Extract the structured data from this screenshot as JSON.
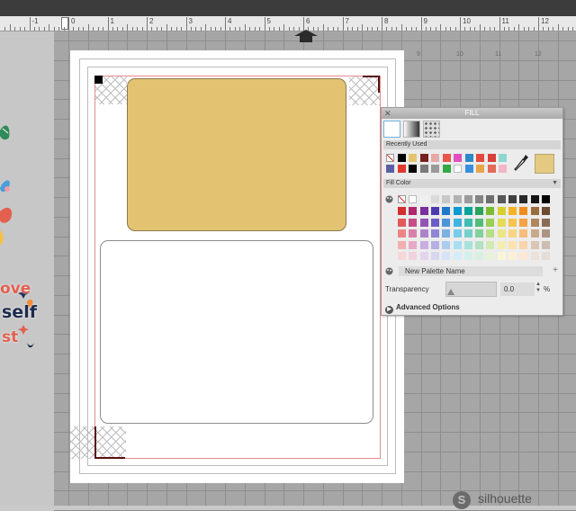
{
  "ruler": {
    "labels": [
      "-1",
      "0",
      "1",
      "2",
      "3",
      "4",
      "5",
      "6",
      "7",
      "8",
      "9",
      "10",
      "11",
      "12"
    ]
  },
  "mat": {
    "numbers": [
      "9",
      "10",
      "11",
      "12"
    ]
  },
  "fill_panel": {
    "title": "FILL",
    "close_glyph": "✕",
    "recently_used_label": "Recently Used",
    "fill_color_label": "Fill Color",
    "palette_name_placeholder": "New Palette Name",
    "transparency_label": "Transparency",
    "transparency_value": "0.0",
    "percent_symbol": "%",
    "advanced_options_label": "Advanced Options",
    "selected_color": "#e4c983",
    "recent_colors_row1": [
      "none",
      "#000000",
      "#e4c46f",
      "#7a1f1f",
      "#e7a9a6",
      "#e8564a",
      "#e04fc0",
      "#2f88c8",
      "#e24a3e",
      "#d9403a",
      "#8fd6d0"
    ],
    "recent_colors_row2": [
      "#5a5fa8",
      "#e03a2e",
      "#000000",
      "#7a7a7a",
      "#9a9a9a",
      "#33aa44",
      "#ffffff",
      "#3a8ee0",
      "#e8a64a",
      "#e46a5a",
      "#f3b6c6"
    ],
    "grays_row": [
      "none",
      "#ffffff",
      "#efefef",
      "#dadada",
      "#c8c8c8",
      "#b2b2b2",
      "#9c9c9c",
      "#858585",
      "#6e6e6e",
      "#575757",
      "#404040",
      "#2a2a2a",
      "#141414",
      "#000000"
    ],
    "color_grid": [
      [
        "#d32f2f",
        "#b0286a",
        "#7b2d9e",
        "#4a3ab2",
        "#1f78c8",
        "#0c9ad3",
        "#0aa39a",
        "#2aa45a",
        "#7bbc33",
        "#d6cf2e",
        "#f4b323",
        "#f08c1b",
        "#9a6c3c",
        "#6e4a2f"
      ],
      [
        "#e35a5a",
        "#c74d87",
        "#9254b5",
        "#6a5cc3",
        "#4a96d6",
        "#42b4e0",
        "#3fbdb3",
        "#52bd7a",
        "#9bcf55",
        "#e4dc55",
        "#f7c350",
        "#f4a345",
        "#b08860",
        "#8c6b55"
      ],
      [
        "#ec8686",
        "#d880aa",
        "#ad84c9",
        "#8f86d4",
        "#7ab2e2",
        "#78cbea",
        "#76d1c9",
        "#82d09d",
        "#b8de86",
        "#ece585",
        "#f9d482",
        "#f7bd7a",
        "#c6a88a",
        "#ad9483"
      ],
      [
        "#f3b0b0",
        "#e6aac7",
        "#c9ade0",
        "#b4b0e3",
        "#a9cdee",
        "#a9def2",
        "#a9e2dc",
        "#b1e2c1",
        "#d1eab2",
        "#f3eeb0",
        "#fbe2b0",
        "#fad4ab",
        "#dac6b3",
        "#cbbdb2"
      ],
      [
        "#f9d6d6",
        "#f1d2e1",
        "#e2d4ee",
        "#d8d6f0",
        "#d3e5f6",
        "#d3eef9",
        "#d3f0ec",
        "#d8f0e0",
        "#e6f3d8",
        "#f9f6d7",
        "#fdf0d7",
        "#fce8d4",
        "#ece1d8",
        "#e4dcd6"
      ]
    ]
  },
  "logo": {
    "mark": "S",
    "text": "silhouette"
  },
  "stickers": {
    "love_word": "ove",
    "self_word": "self",
    "st_word": "st"
  }
}
